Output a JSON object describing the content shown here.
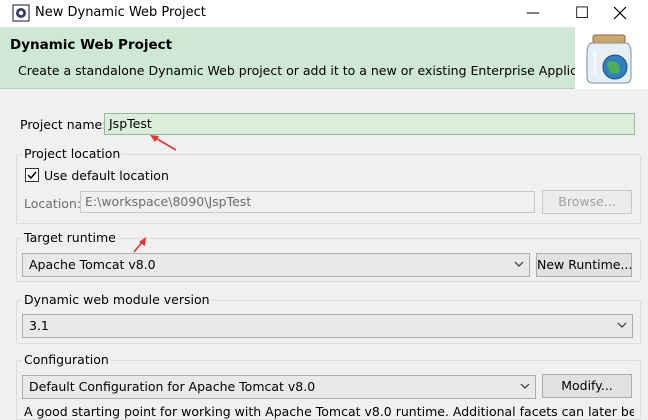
{
  "window": {
    "title": "New Dynamic Web Project",
    "minimize_glyph": "—",
    "maximize_glyph": "☐"
  },
  "banner": {
    "title": "Dynamic Web Project",
    "description": "Create a standalone Dynamic Web project or add it to a new or existing Enterprise Application."
  },
  "project_name": {
    "label": "Project name:",
    "value": "JspTest"
  },
  "project_location": {
    "group_title": "Project location",
    "use_default_label": "Use default location",
    "use_default_checked": true,
    "location_label": "Location:",
    "location_value": "E:\\workspace\\8090\\JspTest",
    "browse_label": "Browse..."
  },
  "target_runtime": {
    "group_title": "Target runtime",
    "selected": "Apache Tomcat v8.0",
    "new_runtime_label": "New Runtime..."
  },
  "module_version": {
    "group_title": "Dynamic web module version",
    "selected": "3.1"
  },
  "configuration": {
    "group_title": "Configuration",
    "selected": "Default Configuration for Apache Tomcat v8.0",
    "modify_label": "Modify...",
    "description": "A good starting point for working with Apache Tomcat v8.0 runtime. Additional facets can later be"
  },
  "colors": {
    "banner_bg": "#cfe8d4",
    "annotation_arrow": "#e8322b"
  }
}
